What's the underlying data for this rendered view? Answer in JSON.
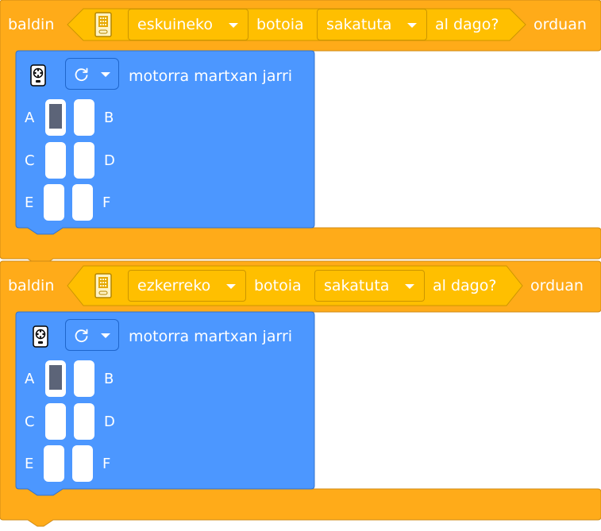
{
  "colors": {
    "control": "#ffab19",
    "control_border": "#cf8b17",
    "sensing": "#ffbf00",
    "motion": "#4c97ff",
    "motion_border": "#3373cc"
  },
  "blocks": [
    {
      "if_label": "baldin",
      "side_value": "eskuineko",
      "button_label": "botoia",
      "state_value": "sakatuta",
      "question_label": "al dago?",
      "then_label": "orduan",
      "motor_icon": "motor-controller-icon",
      "direction_icon": "rotate-clockwise-icon",
      "action_label": "motorra martxan jarri",
      "ports": [
        "A",
        "B",
        "C",
        "D",
        "E",
        "F"
      ],
      "active_port": "A"
    },
    {
      "if_label": "baldin",
      "side_value": "ezkerreko",
      "button_label": "botoia",
      "state_value": "sakatuta",
      "question_label": "al dago?",
      "then_label": "orduan",
      "motor_icon": "motor-controller-icon",
      "direction_icon": "rotate-clockwise-icon",
      "action_label": "motorra martxan jarri",
      "ports": [
        "A",
        "B",
        "C",
        "D",
        "E",
        "F"
      ],
      "active_port": "A"
    }
  ]
}
